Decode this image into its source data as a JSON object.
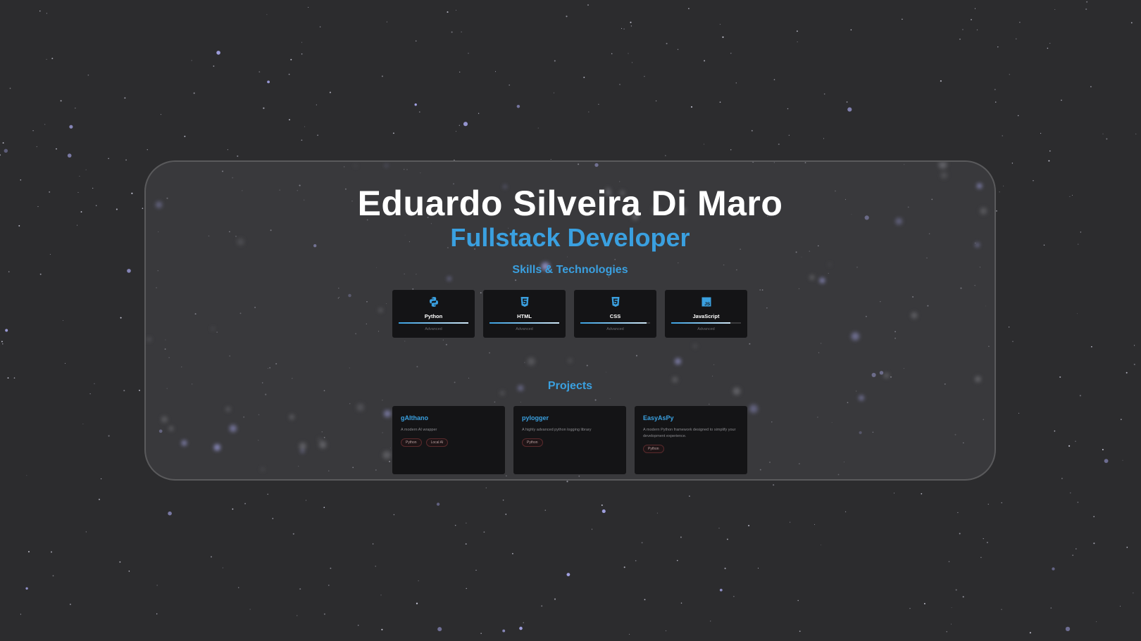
{
  "profile": {
    "name": "Eduardo Silveira Di Maro",
    "role": "Fullstack Developer"
  },
  "skills_section": {
    "title": "Skills & Technologies",
    "items": [
      {
        "name": "Python",
        "level": "Advanced",
        "icon": "python-icon",
        "progress": 1.0
      },
      {
        "name": "HTML",
        "level": "Advanced",
        "icon": "html5-icon",
        "progress": 1.0
      },
      {
        "name": "CSS",
        "level": "Advanced",
        "icon": "css3-icon",
        "progress": 0.95
      },
      {
        "name": "JavaScript",
        "level": "Advanced",
        "icon": "javascript-icon",
        "progress": 0.85
      }
    ]
  },
  "projects_section": {
    "title": "Projects",
    "items": [
      {
        "name": "gAIthano",
        "description": "A modern AI wrapper",
        "tags": [
          "Python",
          "Local AI"
        ]
      },
      {
        "name": "pylogger",
        "description": "A highly advanced python logging library",
        "tags": [
          "Python"
        ]
      },
      {
        "name": "EasyAsPy",
        "description": "A modern Python framework designed to simplify your development experience.",
        "tags": [
          "Python"
        ]
      }
    ]
  },
  "colors": {
    "background": "#2c2c2e",
    "accent": "#3aa0e0",
    "star": "#b4b4ff"
  }
}
